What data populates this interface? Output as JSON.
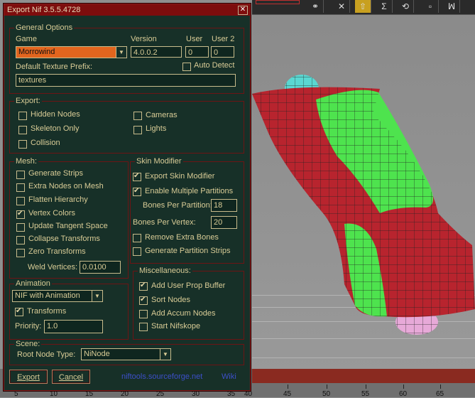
{
  "dialog": {
    "title": "Export Nif 3.5.5.4728",
    "close_glyph": "✕",
    "general": {
      "legend": "General Options",
      "game_label": "Game",
      "game_value": "Morrowind",
      "version_label": "Version",
      "version_value": "4.0.0.2",
      "user_label": "User",
      "user_value": "0",
      "user2_label": "User 2",
      "user2_value": "0",
      "texture_prefix_label": "Default Texture Prefix:",
      "texture_prefix_value": "textures",
      "auto_detect_label": "Auto Detect",
      "auto_detect_checked": false
    },
    "export": {
      "legend": "Export:",
      "hidden_nodes": {
        "label": "Hidden Nodes",
        "checked": false
      },
      "skeleton_only": {
        "label": "Skeleton Only",
        "checked": false
      },
      "collision": {
        "label": "Collision",
        "checked": false
      },
      "cameras": {
        "label": "Cameras",
        "checked": false
      },
      "lights": {
        "label": "Lights",
        "checked": false
      }
    },
    "mesh": {
      "legend": "Mesh:",
      "generate_strips": {
        "label": "Generate Strips",
        "checked": false
      },
      "extra_nodes": {
        "label": "Extra Nodes on Mesh",
        "checked": false
      },
      "flatten_hierarchy": {
        "label": "Flatten Hierarchy",
        "checked": false
      },
      "vertex_colors": {
        "label": "Vertex Colors",
        "checked": true
      },
      "update_tangent": {
        "label": "Update Tangent Space",
        "checked": false
      },
      "collapse_transforms": {
        "label": "Collapse Transforms",
        "checked": false
      },
      "zero_transforms": {
        "label": "Zero Transforms",
        "checked": false
      },
      "weld_label": "Weld Vertices:",
      "weld_value": "0.0100"
    },
    "skin": {
      "legend": "Skin Modifier",
      "export_skin": {
        "label": "Export Skin Modifier",
        "checked": true
      },
      "multi_partitions": {
        "label": "Enable Multiple Partitions",
        "checked": true
      },
      "bones_per_partition_label": "Bones Per Partition:",
      "bones_per_partition_value": "18",
      "bones_per_vertex_label": "Bones Per Vertex:",
      "bones_per_vertex_value": "20",
      "remove_extra_bones": {
        "label": "Remove Extra Bones",
        "checked": false
      },
      "partition_strips": {
        "label": "Generate Partition Strips",
        "checked": false
      }
    },
    "animation": {
      "legend": "Animation",
      "mode_value": "NIF with Animation",
      "transforms": {
        "label": "Transforms",
        "checked": true
      },
      "priority_label": "Priority:",
      "priority_value": "1.0"
    },
    "misc": {
      "legend": "Miscellaneous:",
      "user_prop_buffer": {
        "label": "Add User Prop Buffer",
        "checked": true
      },
      "sort_nodes": {
        "label": "Sort Nodes",
        "checked": true
      },
      "accum_nodes": {
        "label": "Add Accum Nodes",
        "checked": false
      },
      "start_nifskope": {
        "label": "Start Nifskope",
        "checked": false
      }
    },
    "scene": {
      "legend": "Scene:",
      "root_node_label": "Root Node Type:",
      "root_node_value": "NiNode"
    },
    "buttons": {
      "export_label": "Export",
      "cancel_label": "Cancel"
    },
    "links": {
      "site": "niftools.sourceforge.net",
      "wiki": "Wiki"
    }
  },
  "timeline": {
    "ticks": [
      "40",
      "45",
      "50",
      "55",
      "60",
      "65"
    ],
    "left_ticks": [
      "5",
      "10",
      "15",
      "20",
      "25",
      "30",
      "35"
    ]
  },
  "colors": {
    "dialog_bg": "#173028",
    "accent_red": "#7d0d0d",
    "text": "#d9cc96",
    "mesh_red": "#b8242e",
    "mesh_green": "#4ee34e",
    "sphere_cyan": "#5ad7d2",
    "sphere_pink": "#e7a9d8",
    "link_blue": "#3c4fc8"
  }
}
